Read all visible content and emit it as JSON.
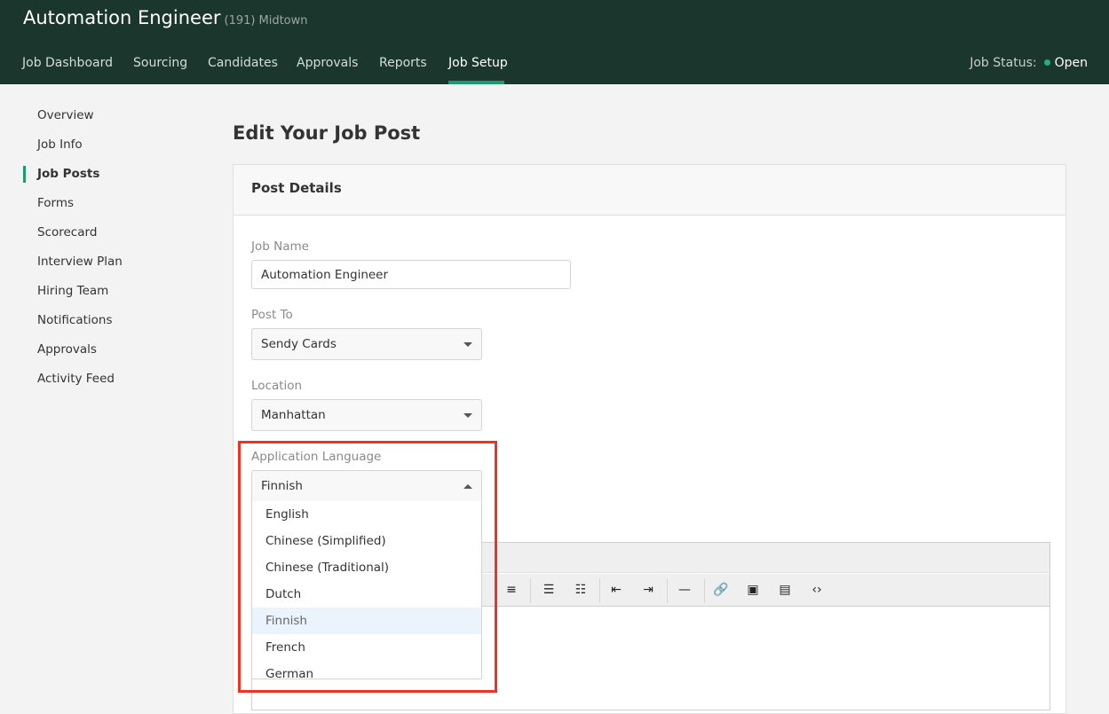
{
  "header": {
    "title": "Automation Engineer",
    "job_id": "(191)",
    "office": "Midtown",
    "nav": [
      {
        "label": "Job Dashboard"
      },
      {
        "label": "Sourcing"
      },
      {
        "label": "Candidates"
      },
      {
        "label": "Approvals"
      },
      {
        "label": "Reports"
      },
      {
        "label": "Job Setup",
        "active": true
      }
    ],
    "status_label": "Job Status:",
    "status_value": "Open",
    "status_color": "#20b27a"
  },
  "sidebar": {
    "items": [
      {
        "label": "Overview"
      },
      {
        "label": "Job Info"
      },
      {
        "label": "Job Posts",
        "active": true
      },
      {
        "label": "Forms"
      },
      {
        "label": "Scorecard"
      },
      {
        "label": "Interview Plan"
      },
      {
        "label": "Hiring Team"
      },
      {
        "label": "Notifications"
      },
      {
        "label": "Approvals"
      },
      {
        "label": "Activity Feed"
      }
    ]
  },
  "main": {
    "page_title": "Edit Your Job Post",
    "card_title": "Post Details",
    "job_name": {
      "label": "Job Name",
      "value": "Automation Engineer"
    },
    "post_to": {
      "label": "Post To",
      "value": "Sendy Cards"
    },
    "location": {
      "label": "Location",
      "value": "Manhattan"
    },
    "language": {
      "label": "Application Language",
      "value": "Finnish",
      "options": [
        "English",
        "Chinese (Simplified)",
        "Chinese (Traditional)",
        "Dutch",
        "Finnish",
        "French",
        "German"
      ],
      "highlighted": "Finnish"
    },
    "toolbar_icons": [
      "align-right-icon",
      "bullet-list-icon",
      "numbered-list-icon",
      "outdent-icon",
      "indent-icon",
      "horizontal-rule-icon",
      "link-icon",
      "image-icon",
      "video-icon",
      "code-icon"
    ]
  },
  "colors": {
    "header_bg": "#1a362d",
    "accent": "#1a9a70",
    "highlight_box": "#ee3322"
  }
}
